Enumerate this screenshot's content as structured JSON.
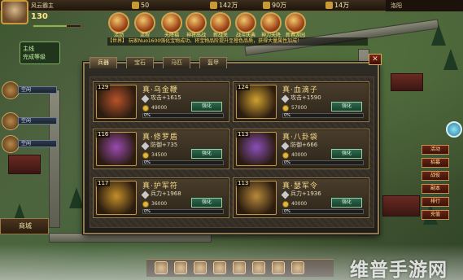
{
  "player": {
    "name": "风云霸主",
    "level": "130"
  },
  "resources": [
    {
      "icon": "gold-icon",
      "value": "50"
    },
    {
      "icon": "grain-icon",
      "value": "142万"
    },
    {
      "icon": "silver-icon",
      "value": "90万"
    },
    {
      "icon": "map-icon",
      "value": "14万"
    }
  ],
  "top_icons": [
    {
      "icon": "trophy-icon",
      "label": "活动"
    },
    {
      "icon": "ritual-icon",
      "label": "流程"
    },
    {
      "icon": "gift-icon",
      "label": "天降福"
    },
    {
      "icon": "army-icon",
      "label": "神将出战"
    },
    {
      "icon": "battle-icon",
      "label": "新战关"
    },
    {
      "icon": "fire-icon",
      "label": "战斗庆典"
    },
    {
      "icon": "blade-icon",
      "label": "神刀天降"
    },
    {
      "icon": "treasure-icon",
      "label": "新春游园"
    }
  ],
  "ticker": "【世界】 玩家Nuo1600强化宝物成功，将宝物品阶提升至橙色品质，获得大量属性加成！",
  "task": {
    "title": "主线",
    "text": "完成等级"
  },
  "side_slots": [
    {
      "label": "空闲"
    },
    {
      "label": "空闲"
    },
    {
      "label": "空闲"
    }
  ],
  "dock_left": {
    "label": "商城"
  },
  "right_buttons": [
    "活动",
    "招募",
    "战役",
    "副本",
    "排行",
    "充值"
  ],
  "tabs": [
    {
      "label": "兵器",
      "active": true
    },
    {
      "label": "宝石",
      "active": false
    },
    {
      "label": "马匹",
      "active": false
    },
    {
      "label": "盔甲",
      "active": false
    }
  ],
  "cards": [
    {
      "level": "129",
      "name": "真·乌金鞭",
      "stat_icon": "sword-icon",
      "stat": "攻击+1615",
      "cost": "49000",
      "button": "强化",
      "progress_label": "0%",
      "progress": 0,
      "art_color": "#b8522a"
    },
    {
      "level": "124",
      "name": "真·血滴子",
      "stat_icon": "sword-icon",
      "stat": "攻击+1590",
      "cost": "57000",
      "button": "强化",
      "progress_label": "0%",
      "progress": 0,
      "art_color": "#d0a030"
    },
    {
      "level": "116",
      "name": "真·修罗盾",
      "stat_icon": "shield-icon",
      "stat": "防御+735",
      "cost": "34500",
      "button": "强化",
      "progress_label": "0%",
      "progress": 0,
      "art_color": "#9a4ab0"
    },
    {
      "level": "113",
      "name": "真·八卦袋",
      "stat_icon": "shield-icon",
      "stat": "防御+666",
      "cost": "40000",
      "button": "强化",
      "progress_label": "0%",
      "progress": 0,
      "art_color": "#8b4fb8"
    },
    {
      "level": "117",
      "name": "真·护军符",
      "stat_icon": "troop-icon",
      "stat": "兵力+1968",
      "cost": "36000",
      "button": "强化",
      "progress_label": "0%",
      "progress": 0,
      "art_color": "#c48f2a"
    },
    {
      "level": "113",
      "name": "真·瑟军令",
      "stat_icon": "troop-icon",
      "stat": "兵力+1936",
      "cost": "40000",
      "button": "强化",
      "progress_label": "0%",
      "progress": 0,
      "art_color": "#b8893a"
    }
  ],
  "watermark": "维普手游网",
  "minimap": "洛阳"
}
